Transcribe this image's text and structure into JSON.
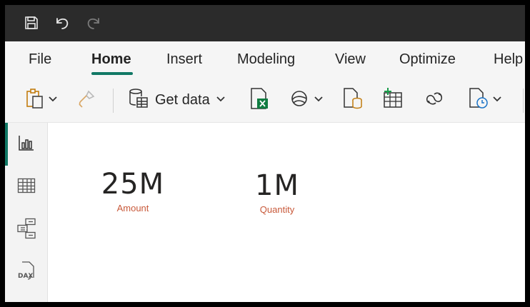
{
  "titlebar": {
    "icons": [
      "save-icon",
      "undo-icon",
      "redo-icon"
    ]
  },
  "menu": {
    "tabs": [
      {
        "label": "File"
      },
      {
        "label": "Home"
      },
      {
        "label": "Insert"
      },
      {
        "label": "Modeling"
      },
      {
        "label": "View"
      },
      {
        "label": "Optimize"
      },
      {
        "label": "Help"
      }
    ],
    "active": "Home"
  },
  "ribbon": {
    "get_data_label": "Get data",
    "icons": [
      "paste-icon",
      "format-painter-icon",
      "get-data-icon",
      "excel-icon",
      "onelake-icon",
      "sql-server-icon",
      "enter-data-icon",
      "dataverse-icon",
      "recent-sources-icon"
    ]
  },
  "leftnav": {
    "items": [
      "report-view-icon",
      "table-view-icon",
      "model-view-icon",
      "dax-query-view-icon"
    ],
    "active": "report-view-icon"
  },
  "cards": [
    {
      "value": "25M",
      "label": "Amount"
    },
    {
      "value": "1M",
      "label": "Quantity"
    }
  ],
  "colors": {
    "accent": "#117865",
    "title_bar": "#2b2b2b",
    "card_label": "#c8593a"
  }
}
